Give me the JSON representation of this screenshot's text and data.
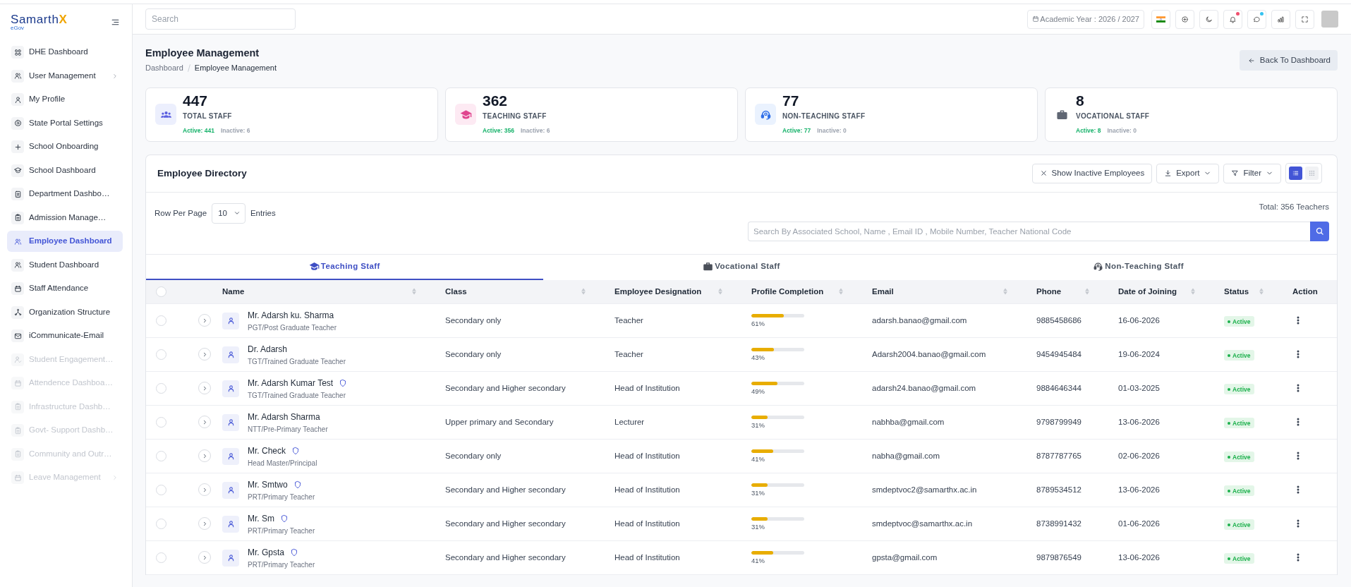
{
  "sidebar": {
    "logo": {
      "wordmark": "Samarth",
      "accent": "X",
      "tagline": "eGov"
    },
    "items": [
      {
        "label": "DHE Dashboard",
        "selected": false,
        "disabled": false,
        "has_submenu": false
      },
      {
        "label": "User Management",
        "selected": false,
        "disabled": false,
        "has_submenu": true
      },
      {
        "label": "My Profile",
        "selected": false,
        "disabled": false,
        "has_submenu": false
      },
      {
        "label": "State Portal Settings",
        "selected": false,
        "disabled": false,
        "has_submenu": false
      },
      {
        "label": "School Onboarding",
        "selected": false,
        "disabled": false,
        "has_submenu": false
      },
      {
        "label": "School Dashboard",
        "selected": false,
        "disabled": false,
        "has_submenu": false
      },
      {
        "label": "Department Dashbo…",
        "selected": false,
        "disabled": false,
        "has_submenu": false
      },
      {
        "label": "Admission Manage…",
        "selected": false,
        "disabled": false,
        "has_submenu": false
      },
      {
        "label": "Employee Dashboard",
        "selected": true,
        "disabled": false,
        "has_submenu": false
      },
      {
        "label": "Student Dashboard",
        "selected": false,
        "disabled": false,
        "has_submenu": false
      },
      {
        "label": "Staff Attendance",
        "selected": false,
        "disabled": false,
        "has_submenu": false
      },
      {
        "label": "Organization Structure",
        "selected": false,
        "disabled": false,
        "has_submenu": false
      },
      {
        "label": "iCommunicate-Email",
        "selected": false,
        "disabled": false,
        "has_submenu": false
      },
      {
        "label": "Student Engagement…",
        "selected": false,
        "disabled": true,
        "has_submenu": false
      },
      {
        "label": "Attendence Dashboa…",
        "selected": false,
        "disabled": true,
        "has_submenu": false
      },
      {
        "label": "Infrastructure Dashb…",
        "selected": false,
        "disabled": true,
        "has_submenu": false
      },
      {
        "label": "Govt- Support Dashb…",
        "selected": false,
        "disabled": true,
        "has_submenu": false
      },
      {
        "label": "Community and Outr…",
        "selected": false,
        "disabled": true,
        "has_submenu": false
      },
      {
        "label": "Leave Management",
        "selected": false,
        "disabled": true,
        "has_submenu": true
      }
    ]
  },
  "topbar": {
    "search": {
      "placeholder": "Search"
    },
    "academic_year": "Academic Year : 2026 / 2027",
    "notifications_unread": true,
    "messages_unread": true
  },
  "header": {
    "title": "Employee Management",
    "breadcrumb": [
      {
        "label": "Dashboard"
      },
      {
        "label": "Employee Management"
      }
    ],
    "back_button": "Back To Dashboard"
  },
  "stats": [
    {
      "value": "447",
      "label": "TOTAL STAFF",
      "active": "Active: 441",
      "inactive": "Inactive: 6"
    },
    {
      "value": "362",
      "label": "TEACHING STAFF",
      "active": "Active: 356",
      "inactive": "Inactive: 6"
    },
    {
      "value": "77",
      "label": "NON-TEACHING STAFF",
      "active": "Active: 77",
      "inactive": "Inactive: 0"
    },
    {
      "value": "8",
      "label": "VOCATIONAL STAFF",
      "active": "Active: 8",
      "inactive": "Inactive: 0"
    }
  ],
  "directory": {
    "title": "Employee Directory",
    "show_inactive_button": "Show Inactive Employees",
    "export_button": "Export",
    "filter_button": "Filter",
    "view_modes": [
      {
        "selected": true
      },
      {
        "selected": false
      }
    ],
    "rows_per_page": {
      "label": "Row Per Page",
      "value": "10",
      "suffix": "Entries"
    },
    "total": "Total: 356 Teachers",
    "search": {
      "placeholder": "Search By Associated School, Name , Email ID , Mobile Number, Teacher National Code"
    },
    "tabs": [
      {
        "label": "Teaching Staff",
        "selected": true
      },
      {
        "label": "Vocational Staff",
        "selected": false
      },
      {
        "label": "Non-Teaching Staff",
        "selected": false
      }
    ],
    "table": {
      "select_all": {
        "checked": false
      },
      "columns": [
        {
          "label": "Name",
          "sortable": true
        },
        {
          "label": "Class",
          "sortable": true
        },
        {
          "label": "Employee Designation",
          "sortable": true
        },
        {
          "label": "Profile Completion",
          "sortable": true
        },
        {
          "label": "Email",
          "sortable": true
        },
        {
          "label": "Phone",
          "sortable": true
        },
        {
          "label": "Date of Joining",
          "sortable": true
        },
        {
          "label": "Status",
          "sortable": true
        },
        {
          "label": "Action",
          "sortable": false
        }
      ],
      "rows": [
        {
          "checked": false,
          "expanded": false,
          "name": "Mr. Adarsh ku. Sharma",
          "has_badge": false,
          "role": "PGT/Post Graduate Teacher",
          "class": "Secondary only",
          "designation": "Teacher",
          "level": 0.61,
          "completion": "61%",
          "email": "adarsh.banao@gmail.com",
          "phone": "9885458686",
          "joined": "16-06-2026",
          "status": "Active"
        },
        {
          "checked": false,
          "expanded": false,
          "name": "Dr. Adarsh",
          "has_badge": false,
          "role": "TGT/Trained Graduate Teacher",
          "class": "Secondary only",
          "designation": "Teacher",
          "level": 0.43,
          "completion": "43%",
          "email": "Adarsh2004.banao@gmail.com",
          "phone": "9454945484",
          "joined": "19-06-2024",
          "status": "Active"
        },
        {
          "checked": false,
          "expanded": false,
          "name": "Mr. Adarsh Kumar Test",
          "has_badge": true,
          "role": "TGT/Trained Graduate Teacher",
          "class": "Secondary and Higher secondary",
          "designation": "Head of Institution",
          "level": 0.49,
          "completion": "49%",
          "email": "adarsh24.banao@gmail.com",
          "phone": "9884646344",
          "joined": "01-03-2025",
          "status": "Active"
        },
        {
          "checked": false,
          "expanded": false,
          "name": "Mr. Adarsh Sharma",
          "has_badge": false,
          "role": "NTT/Pre-Primary Teacher",
          "class": "Upper primary and Secondary",
          "designation": "Lecturer",
          "level": 0.31,
          "completion": "31%",
          "email": "nabhba@gmail.com",
          "phone": "9798799949",
          "joined": "13-06-2026",
          "status": "Active"
        },
        {
          "checked": false,
          "expanded": false,
          "name": "Mr. Check",
          "has_badge": true,
          "role": "Head Master/Principal",
          "class": "Secondary only",
          "designation": "Head of Institution",
          "level": 0.41,
          "completion": "41%",
          "email": "nabha@gmail.com",
          "phone": "8787787765",
          "joined": "02-06-2026",
          "status": "Active"
        },
        {
          "checked": false,
          "expanded": false,
          "name": "Mr. Smtwo",
          "has_badge": true,
          "role": "PRT/Primary Teacher",
          "class": "Secondary and Higher secondary",
          "designation": "Head of Institution",
          "level": 0.31,
          "completion": "31%",
          "email": "smdeptvoc2@samarthx.ac.in",
          "phone": "8789534512",
          "joined": "13-06-2026",
          "status": "Active"
        },
        {
          "checked": false,
          "expanded": false,
          "name": "Mr. Sm",
          "has_badge": true,
          "role": "PRT/Primary Teacher",
          "class": "Secondary and Higher secondary",
          "designation": "Head of Institution",
          "level": 0.31,
          "completion": "31%",
          "email": "smdeptvoc@samarthx.ac.in",
          "phone": "8738991432",
          "joined": "01-06-2026",
          "status": "Active"
        },
        {
          "checked": false,
          "expanded": false,
          "name": "Mr. Gpsta",
          "has_badge": true,
          "role": "PRT/Primary Teacher",
          "class": "Secondary and Higher secondary",
          "designation": "Head of Institution",
          "level": 0.41,
          "completion": "41%",
          "email": "gpsta@gmail.com",
          "phone": "9879876549",
          "joined": "13-06-2026",
          "status": "Active"
        }
      ]
    }
  }
}
